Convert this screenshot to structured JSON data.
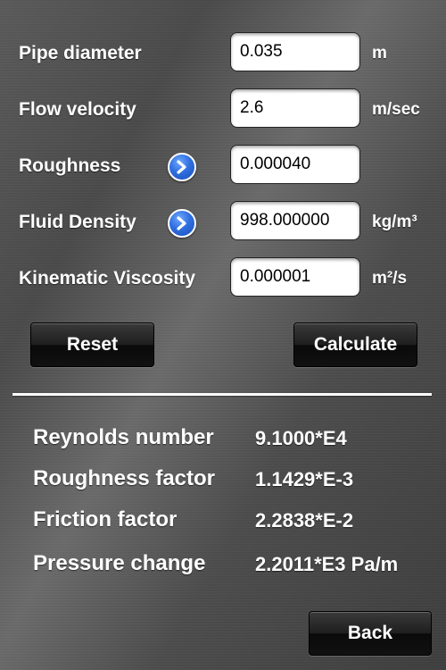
{
  "inputs": [
    {
      "label": "Pipe diameter",
      "value": "0.035",
      "unit": "m"
    },
    {
      "label": "Flow velocity",
      "value": "2.6",
      "unit": "m/sec"
    },
    {
      "label": "Roughness",
      "value": "0.000040",
      "unit": ""
    },
    {
      "label": "Fluid Density",
      "value": "998.000000",
      "unit": "kg/m³"
    },
    {
      "label": "Kinematic Viscosity",
      "value": "0.000001",
      "unit": "m²/s"
    }
  ],
  "buttons": {
    "reset": "Reset",
    "calculate": "Calculate",
    "back": "Back"
  },
  "results": [
    {
      "label": "Reynolds number",
      "value": "9.1000*E4"
    },
    {
      "label": "Roughness factor",
      "value": "1.1429*E-3"
    },
    {
      "label": "Friction factor",
      "value": "2.2838*E-2"
    },
    {
      "label": "Pressure change",
      "value": "2.2011*E3 Pa/m"
    }
  ],
  "colors": {
    "disclosure": "#2f6fe0",
    "button": "#1e1e1e",
    "background": "#4a4a4a"
  }
}
